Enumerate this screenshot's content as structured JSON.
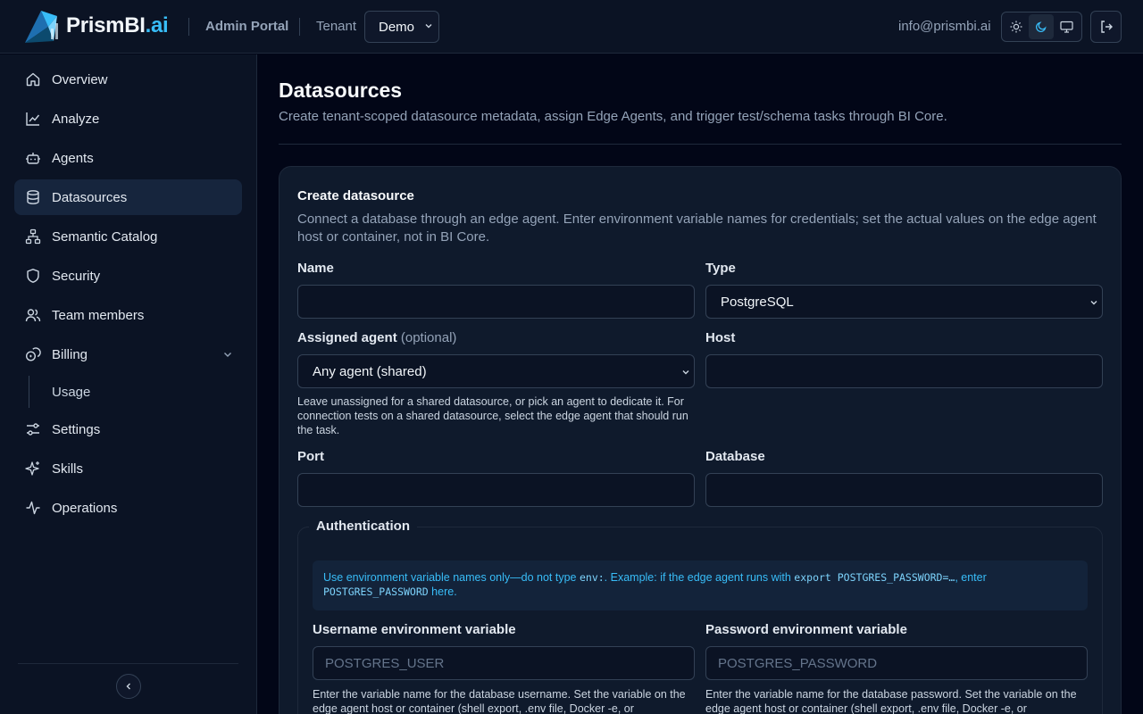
{
  "header": {
    "brand_name": "PrismBI",
    "brand_tld": ".ai",
    "portal_label": "Admin Portal",
    "tenant_label": "Tenant",
    "tenant_value": "Demo",
    "user_email": "info@prismbi.ai",
    "theme_options": [
      "light",
      "dark",
      "system"
    ],
    "theme_selected": "dark",
    "logout_icon": "logout-icon"
  },
  "sidebar": {
    "items": [
      {
        "label": "Overview",
        "icon": "home-icon"
      },
      {
        "label": "Analyze",
        "icon": "chart-line-icon"
      },
      {
        "label": "Agents",
        "icon": "bot-icon"
      },
      {
        "label": "Datasources",
        "icon": "database-icon",
        "active": true
      },
      {
        "label": "Semantic Catalog",
        "icon": "network-icon"
      },
      {
        "label": "Security",
        "icon": "shield-icon"
      },
      {
        "label": "Team members",
        "icon": "users-icon"
      },
      {
        "label": "Billing",
        "icon": "coins-icon",
        "expanded": true
      },
      {
        "label": "Usage",
        "sub": true
      },
      {
        "label": "Settings",
        "icon": "sliders-icon"
      },
      {
        "label": "Skills",
        "icon": "sparkles-icon"
      },
      {
        "label": "Operations",
        "icon": "activity-icon"
      }
    ]
  },
  "main": {
    "title": "Datasources",
    "subtitle": "Create tenant-scoped datasource metadata, assign Edge Agents, and trigger test/schema tasks through BI Core.",
    "card": {
      "title": "Create datasource",
      "description": "Connect a database through an edge agent. Enter environment variable names for credentials; set the actual values on the edge agent host or container, not in BI Core.",
      "fields": {
        "name": {
          "label": "Name",
          "value": ""
        },
        "type": {
          "label": "Type",
          "value": "PostgreSQL"
        },
        "agent": {
          "label": "Assigned agent",
          "label_suffix": "(optional)",
          "value": "Any agent (shared)",
          "help": "Leave unassigned for a shared datasource, or pick an agent to dedicate it. For connection tests on a shared datasource, select the edge agent that should run the task."
        },
        "host": {
          "label": "Host",
          "value": ""
        },
        "port": {
          "label": "Port",
          "value": ""
        },
        "database": {
          "label": "Database",
          "value": ""
        }
      },
      "auth": {
        "legend": "Authentication",
        "info_prefix": "Use environment variable names only—do not type ",
        "info_code1": "env:",
        "info_mid": ". Example: if the edge agent runs with ",
        "info_code2": "export POSTGRES_PASSWORD=…",
        "info_mid2": ", enter ",
        "info_code3": "POSTGRES_PASSWORD",
        "info_suffix": " here.",
        "username_label": "Username environment variable",
        "username_placeholder": "POSTGRES_USER",
        "username_help": "Enter the variable name for the database username. Set the variable on the edge agent host or container (shell export, .env file, Docker -e, or",
        "password_label": "Password environment variable",
        "password_placeholder": "POSTGRES_PASSWORD",
        "password_help": "Enter the variable name for the database password. Set the variable on the edge agent host or container (shell export, .env file, Docker -e, or"
      }
    }
  },
  "colors": {
    "background": "#020617",
    "panel": "#0b1324",
    "accent": "#38bdf8",
    "active_nav": "#16253d"
  }
}
